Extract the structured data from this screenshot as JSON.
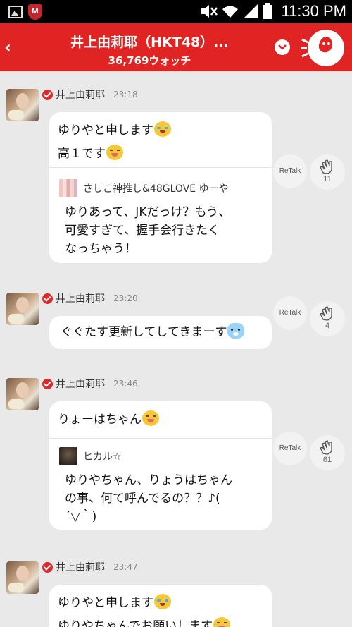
{
  "status_bar": {
    "time": "11:30 PM"
  },
  "header": {
    "title": "井上由莉耶（HKT48）...",
    "watch_count": "36,769ウォッチ"
  },
  "messages": [
    {
      "name": "井上由莉耶",
      "time": "23:18",
      "lines": [
        "ゆりやと申します",
        "高１です"
      ],
      "quote": {
        "name": "さしこ神推し&48GLOVE ゆーや",
        "lines": [
          "ゆりあって、JKだっけ？もう、",
          "可愛すぎて、握手会行きたく",
          "なっちゃう！"
        ]
      },
      "retalk": "ReTalk",
      "claps": "11"
    },
    {
      "name": "井上由莉耶",
      "time": "23:20",
      "lines": [
        "ぐぐたす更新してしてきまーす"
      ],
      "retalk": "ReTalk",
      "claps": "4"
    },
    {
      "name": "井上由莉耶",
      "time": "23:46",
      "lines": [
        "りょーはちゃん"
      ],
      "quote": {
        "name": "ヒカル☆",
        "lines": [
          "ゆりやちゃん、りょうはちゃん",
          "の事、何て呼んでるの？？♪(",
          "´▽｀)"
        ]
      },
      "retalk": "ReTalk",
      "claps": "61"
    },
    {
      "name": "井上由莉耶",
      "time": "23:47",
      "lines": [
        "ゆりやと申します",
        "ゆりやちゃんでお願いします"
      ]
    }
  ]
}
